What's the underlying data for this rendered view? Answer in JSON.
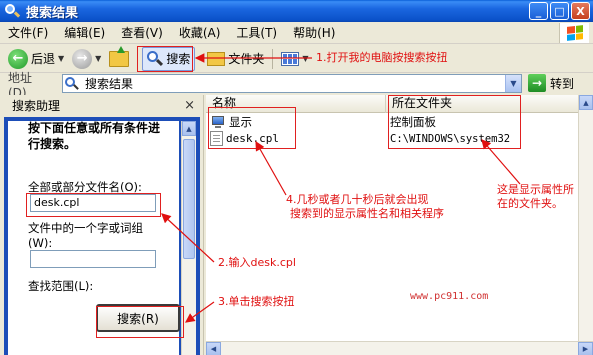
{
  "window": {
    "title": "搜索结果",
    "minimize": "_",
    "maximize": "□",
    "close": "X"
  },
  "menu": [
    "文件(F)",
    "编辑(E)",
    "查看(V)",
    "收藏(A)",
    "工具(T)",
    "帮助(H)"
  ],
  "toolbar": {
    "back_label": "后退",
    "search_label": "搜索",
    "folders_label": "文件夹"
  },
  "address": {
    "label": "地址(D)",
    "value": "搜索结果",
    "go_label": "转到"
  },
  "search_panel": {
    "title": "搜索助理",
    "heading": "按下面任意或所有条件进行搜索。",
    "filename_label": "全部或部分文件名(O):",
    "filename_value": "desk.cpl",
    "phrase_label": "文件中的一个字或词组(W):",
    "phrase_value": "",
    "lookin_label": "查找范围(L):",
    "search_button": "搜索(R)"
  },
  "file_list": {
    "columns": [
      "名称",
      "所在文件夹"
    ],
    "rows": [
      {
        "name": "显示",
        "folder": "控制面板",
        "icon": "display-icon"
      },
      {
        "name": "desk.cpl",
        "folder": "C:\\WINDOWS\\system32",
        "icon": "file-icon"
      }
    ]
  },
  "annotations": {
    "step1": "1.打开我的电脑按搜索按扭",
    "step2": "2.输入desk.cpl",
    "step3": "3.单击搜索按扭",
    "step4_line1": "4.几秒或者几十秒后就会出现",
    "step4_line2": "搜索到的显示属性名和相关程序",
    "folder_note_line1": "这是显示属性所",
    "folder_note_line2": "在的文件夹。",
    "watermark": "www.pc911.com"
  },
  "colors": {
    "titlebar": "#0b52c9",
    "panel_blue": "#1d4eb8",
    "annotation_red": "#e01010"
  }
}
